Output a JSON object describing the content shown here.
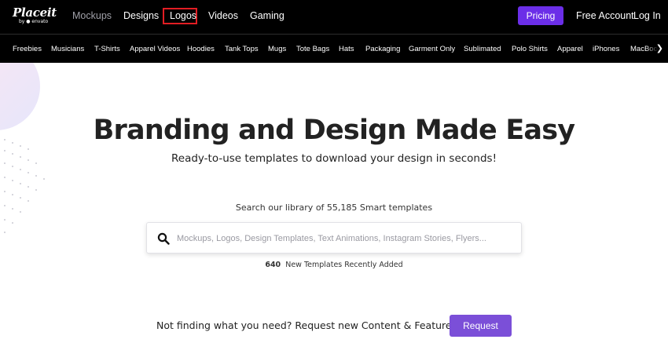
{
  "brand": {
    "name": "Placeit",
    "sub": "by ● envato"
  },
  "nav": {
    "items": [
      {
        "label": "Mockups"
      },
      {
        "label": "Designs"
      },
      {
        "label": "Logos"
      },
      {
        "label": "Videos"
      },
      {
        "label": "Gaming"
      }
    ],
    "pricing": "Pricing",
    "free_account": "Free Account",
    "login": "Log In"
  },
  "categories": {
    "items": [
      "Freebies",
      "Musicians",
      "T-Shirts",
      "Apparel Videos",
      "Hoodies",
      "Tank Tops",
      "Mugs",
      "Tote Bags",
      "Hats",
      "Packaging",
      "Garment Only",
      "Sublimated",
      "Polo Shirts",
      "Apparel",
      "iPhones",
      "MacBoo"
    ],
    "more_icon": "chevron-right-icon"
  },
  "hero": {
    "title": "Branding and Design Made Easy",
    "subtitle": "Ready-to-use templates to download your design in seconds!"
  },
  "search": {
    "caption": "Search our library of 55,185 Smart templates",
    "placeholder": "Mockups, Logos, Design Templates, Text Animations, Instagram Stories, Flyers...",
    "icon": "search-icon"
  },
  "recent": {
    "count": "640",
    "text": "New Templates Recently Added"
  },
  "request": {
    "text": "Not finding what you need? Request new Content & Features",
    "button": "Request"
  },
  "colors": {
    "nav_bg": "#000000",
    "accent": "#6b2ee8",
    "active_outline": "#e21d23",
    "request_btn": "#7b4fd8"
  }
}
